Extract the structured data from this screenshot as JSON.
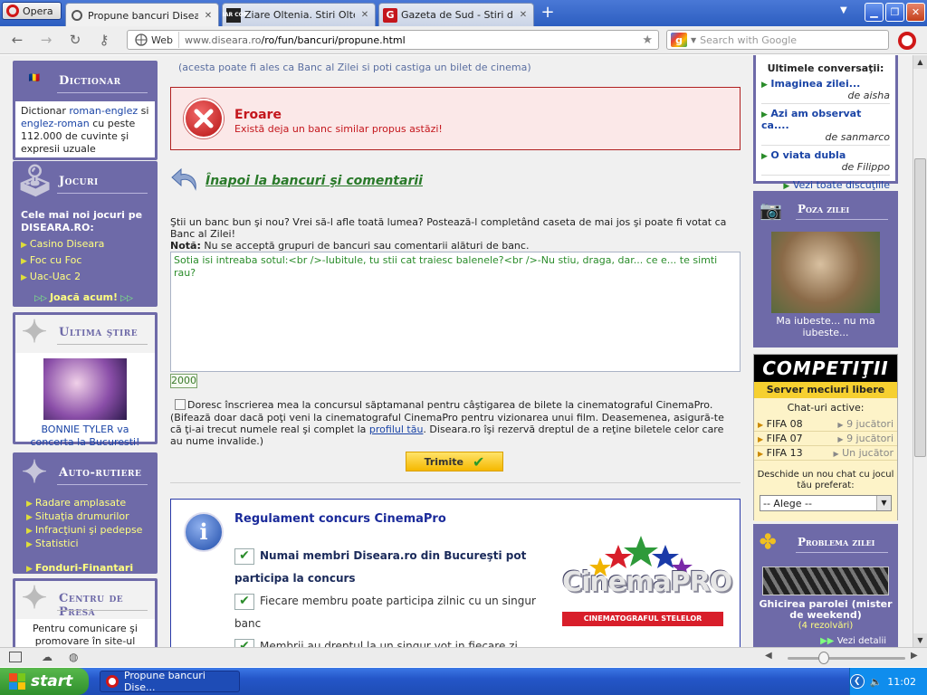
{
  "browser": {
    "opera_label": "Opera",
    "tabs": [
      {
        "title": "Propune bancuri Diseara....",
        "icon": "opera-page-icon",
        "active": true
      },
      {
        "title": "Ziare Oltenia. Stiri Olteni...",
        "icon": "ziar-com-icon",
        "active": false
      },
      {
        "title": "Gazeta de Sud - Stiri din ...",
        "icon": "gazeta-g-icon",
        "active": false
      }
    ],
    "ziar_icon_text": "ZIAR COM",
    "gazeta_icon_text": "G",
    "new_tab": "+",
    "web_badge": "Web",
    "url_host": "www.diseara.ro",
    "url_path": "/ro/fun/bancuri/propune.html",
    "search_placeholder": "Search with Google"
  },
  "left": {
    "dictionar": {
      "title": "Dictionar",
      "text_prefix": "Dictionar ",
      "link1": "roman-englez",
      "text_mid": " si ",
      "link2": "englez-roman",
      "text_suffix": " cu peste 112.000 de cuvinte şi expresii uzuale"
    },
    "jocuri": {
      "title": "Jocuri",
      "intro": "Cele mai noi jocuri pe DISEARA.RO:",
      "items": [
        "Casino Diseara",
        "Foc cu Foc",
        "Uac-Uac 2"
      ],
      "cta": "Joacă acum!"
    },
    "ultima_stire": {
      "title": "Ultima ştire",
      "caption": "BONNIE TYLER va concerta la Bucuresti!"
    },
    "auto": {
      "title": "Auto-rutiere",
      "items": [
        "Radare amplasate",
        "Situaţia drumurilor",
        "Infracţiuni şi pedepse",
        "Statistici"
      ],
      "cta": "Fonduri-Finantari"
    },
    "presa": {
      "title": "Centru de Presa",
      "text": "Pentru comunicare şi promovare în site-ul"
    }
  },
  "center": {
    "top_note": "(acesta poate fi ales ca Banc al Zilei si poti castiga un bilet de cinema)",
    "error_title": "Eroare",
    "error_msg": "Există deja un banc similar propus astăzi!",
    "back_link": "Înapoi la bancuri şi comentarii",
    "intro": "Ştii un banc bun şi nou? Vrei să-l afle toată lumea? Postează-l completând caseta de mai jos şi poate fi votat ca Banc al Zilei!",
    "note_label": "Notă:",
    "note_text": " Nu se acceptă grupuri de bancuri sau comentarii alături de banc.",
    "textarea_value": "Sotia isi intreaba sotul:<br />-Iubitule, tu stii cat traiesc balenele?<br />-Nu stiu, draga, dar... ce e... te simti rau?",
    "char_count": "2000",
    "checkbox_label": "Doresc înscrierea mea la concursul săptamanal pentru câştigarea de bilete la cinematograful CinemaPro.",
    "checkbox_note_1": "(Bifează doar dacă poţi veni la cinematograful CinemaPro pentru vizionarea unui film. Deasemenea, asigură-te că ţi-ai trecut numele real şi complet la ",
    "checkbox_note_link": "profilul tău",
    "checkbox_note_2": ". Diseara.ro îşi rezervă dreptul de a reţine biletele celor care au nume invalide.)",
    "submit": "Trimite",
    "rules_title": "Regulament concurs CinemaPro",
    "rules": [
      "Numai membri Diseara.ro din Bucureşti pot participa la concurs",
      "Fiecare membru poate participa zilnic cu un singur banc",
      "Membrii au dreptul la un singur vot in fiecare zi."
    ],
    "cinemapro_logo": "CinemaPRO",
    "cinemapro_tagline": "CINEMATOGRAFUL STELELOR"
  },
  "right": {
    "convo": {
      "title": "Ultimele conversaţii:",
      "items": [
        {
          "title": "Imaginea zilei...",
          "author": "de aisha"
        },
        {
          "title": "Azi am observat ca....",
          "author": "de sanmarco"
        },
        {
          "title": "O viata dubla",
          "author": "de Filippo"
        }
      ],
      "see_all": "Vezi toate discuţiile"
    },
    "poza": {
      "title": "Poza zilei",
      "caption": "Ma iubeste... nu ma iubeste..."
    },
    "comp": {
      "logo": "COMPETIŢII",
      "subtitle": "Server meciuri libere",
      "chat_label": "Chat-uri active:",
      "chats": [
        {
          "name": "FIFA 08",
          "players": "9 jucători"
        },
        {
          "name": "FIFA 07",
          "players": "9 jucători"
        },
        {
          "name": "FIFA 13",
          "players": "Un jucător"
        }
      ],
      "open_label": "Deschide un nou chat cu jocul tău preferat:",
      "select_value": "-- Alege --"
    },
    "problema": {
      "title": "Problema zilei",
      "caption": "Ghicirea parolei (mister de weekend)",
      "solved": "(4 rezolvări)",
      "more": "Vezi detalii"
    }
  },
  "taskbar": {
    "start": "start",
    "task": "Propune bancuri Dise...",
    "time": "11:02"
  }
}
